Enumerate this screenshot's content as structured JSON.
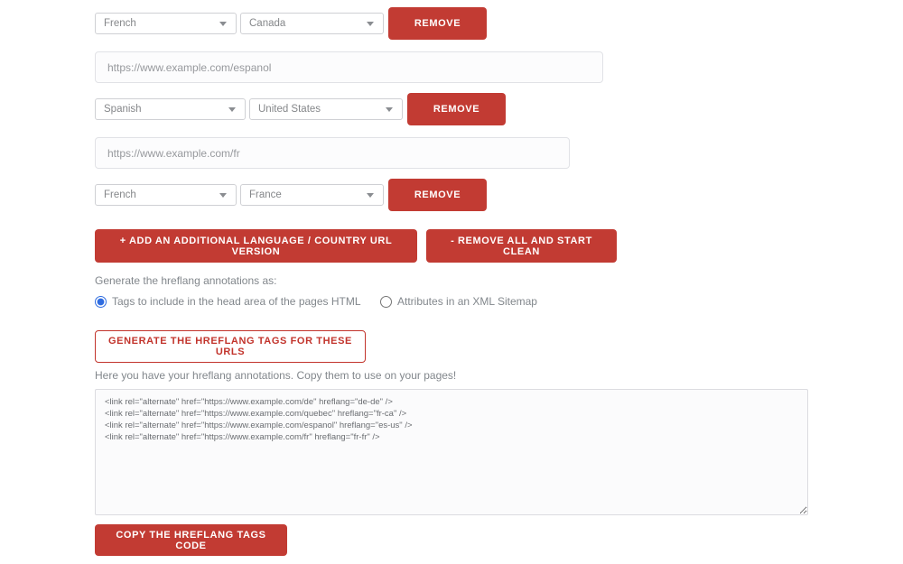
{
  "colors": {
    "accent_red": "#c23b33",
    "outline_red": "#c2342c",
    "radio_selected_blue": "#2f6ce0"
  },
  "entries": [
    {
      "language": "French",
      "country": "Canada"
    },
    {
      "url": "https://www.example.com/espanol",
      "language": "Spanish",
      "country": "United States"
    },
    {
      "url": "https://www.example.com/fr",
      "language": "French",
      "country": "France"
    }
  ],
  "buttons": {
    "remove": "REMOVE",
    "add": "+ ADD AN ADDITIONAL LANGUAGE / COUNTRY URL VERSION",
    "remove_all": "- REMOVE ALL AND START CLEAN",
    "generate": "GENERATE THE HREFLANG TAGS FOR THESE URLS",
    "copy": "COPY THE HREFLANG TAGS CODE"
  },
  "output_format": {
    "label": "Generate the hreflang annotations as:",
    "options": [
      {
        "label": "Tags to include in the head area of the pages HTML",
        "selected": true
      },
      {
        "label": "Attributes in an XML Sitemap",
        "selected": false
      }
    ]
  },
  "result": {
    "intro": "Here you have your hreflang annotations. Copy them to use on your pages!",
    "code": "<link rel=\"alternate\" href=\"https://www.example.com/de\" hreflang=\"de-de\" />\n<link rel=\"alternate\" href=\"https://www.example.com/quebec\" hreflang=\"fr-ca\" />\n<link rel=\"alternate\" href=\"https://www.example.com/espanol\" hreflang=\"es-us\" />\n<link rel=\"alternate\" href=\"https://www.example.com/fr\" hreflang=\"fr-fr\" />"
  }
}
